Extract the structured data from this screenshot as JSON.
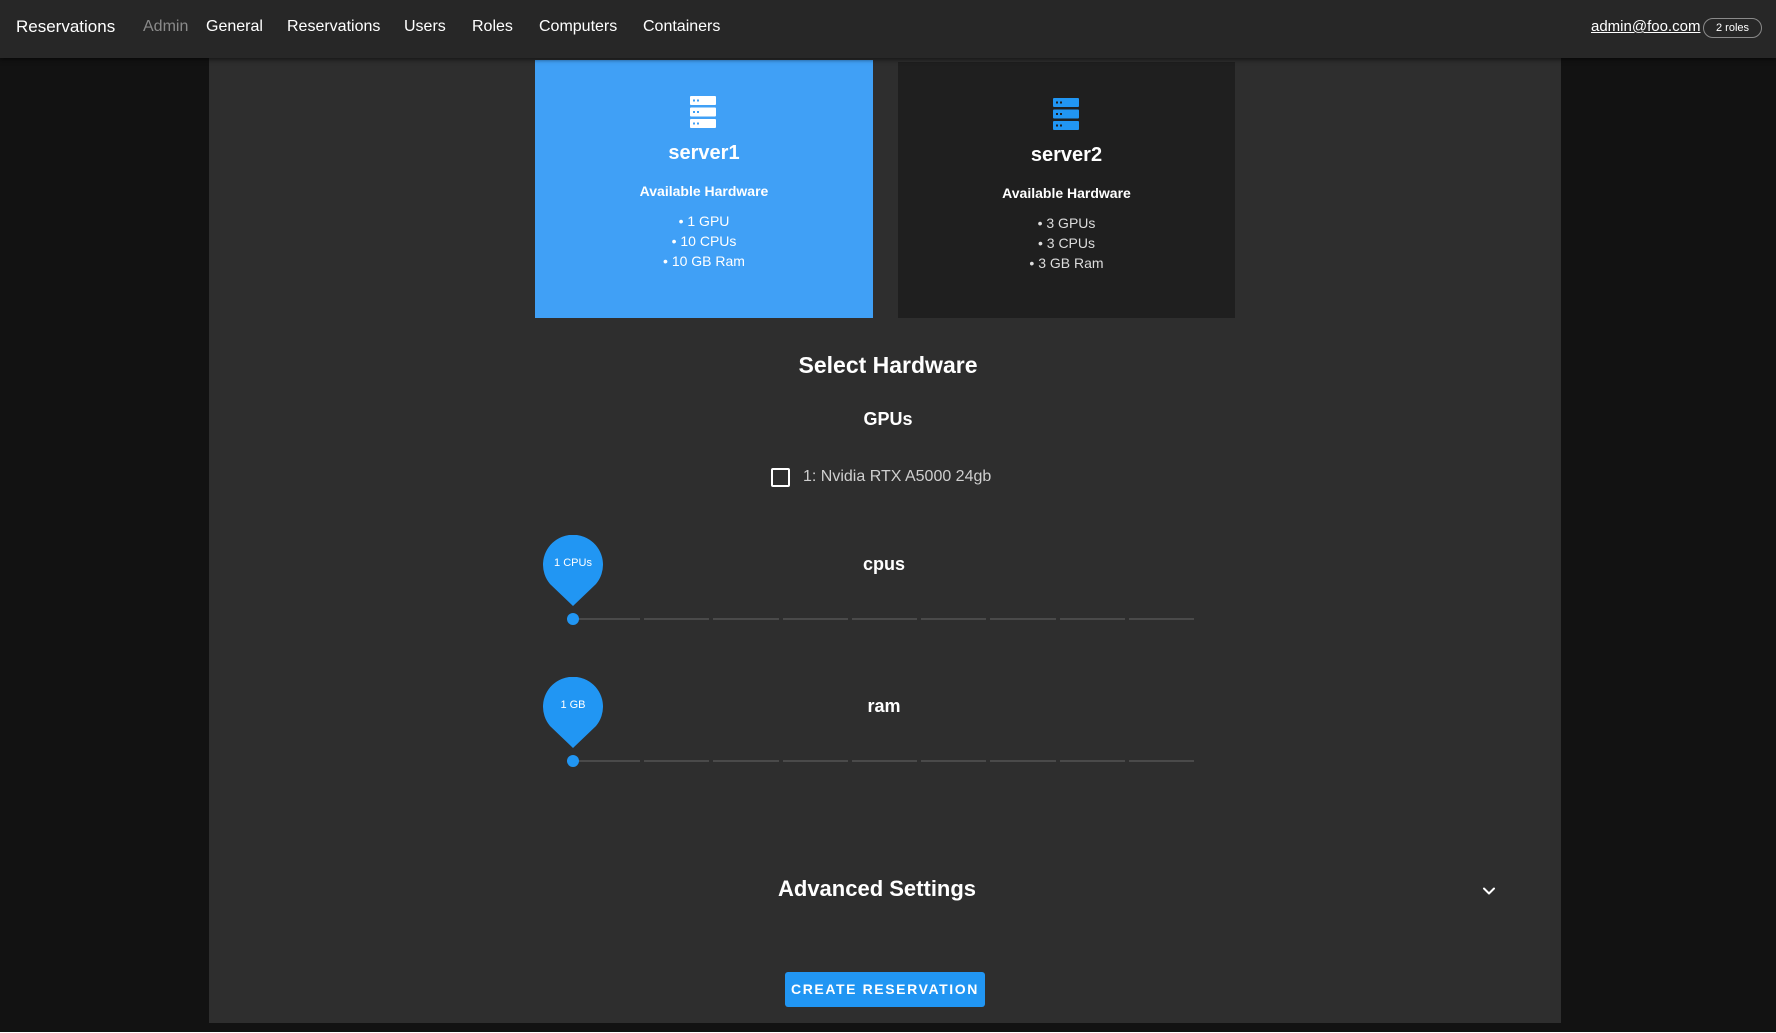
{
  "header": {
    "brand": "Reservations",
    "section": "Admin",
    "nav": [
      "General",
      "Reservations",
      "Users",
      "Roles",
      "Computers",
      "Containers"
    ],
    "user": "admin@foo.com",
    "roles_badge": "2 roles"
  },
  "computers": [
    {
      "name": "server1",
      "hardware_title": "Available Hardware",
      "specs": [
        "• 1 GPU",
        "• 10 CPUs",
        "• 10 GB Ram"
      ],
      "selected": true
    },
    {
      "name": "server2",
      "hardware_title": "Available Hardware",
      "specs": [
        "• 3 GPUs",
        "• 3 CPUs",
        "• 3 GB Ram"
      ],
      "selected": false
    }
  ],
  "select_hardware": {
    "title": "Select Hardware",
    "gpus_title": "GPUs",
    "gpu_option": "1: Nvidia RTX A5000 24gb",
    "gpu_checked": false,
    "cpus": {
      "label": "cpus",
      "value_label": "1 CPUs",
      "value": 1,
      "min": 1,
      "max": 10
    },
    "ram": {
      "label": "ram",
      "value_label": "1 GB",
      "value": 1,
      "min": 1,
      "max": 10
    }
  },
  "advanced_settings": {
    "label": "Advanced Settings",
    "expanded": false
  },
  "create_button": "CREATE RESERVATION",
  "colors": {
    "accent": "#2196f3",
    "selected_card": "#40a0f6",
    "panel": "#2e2e2e",
    "topbar": "#272727",
    "background": "#121212"
  }
}
